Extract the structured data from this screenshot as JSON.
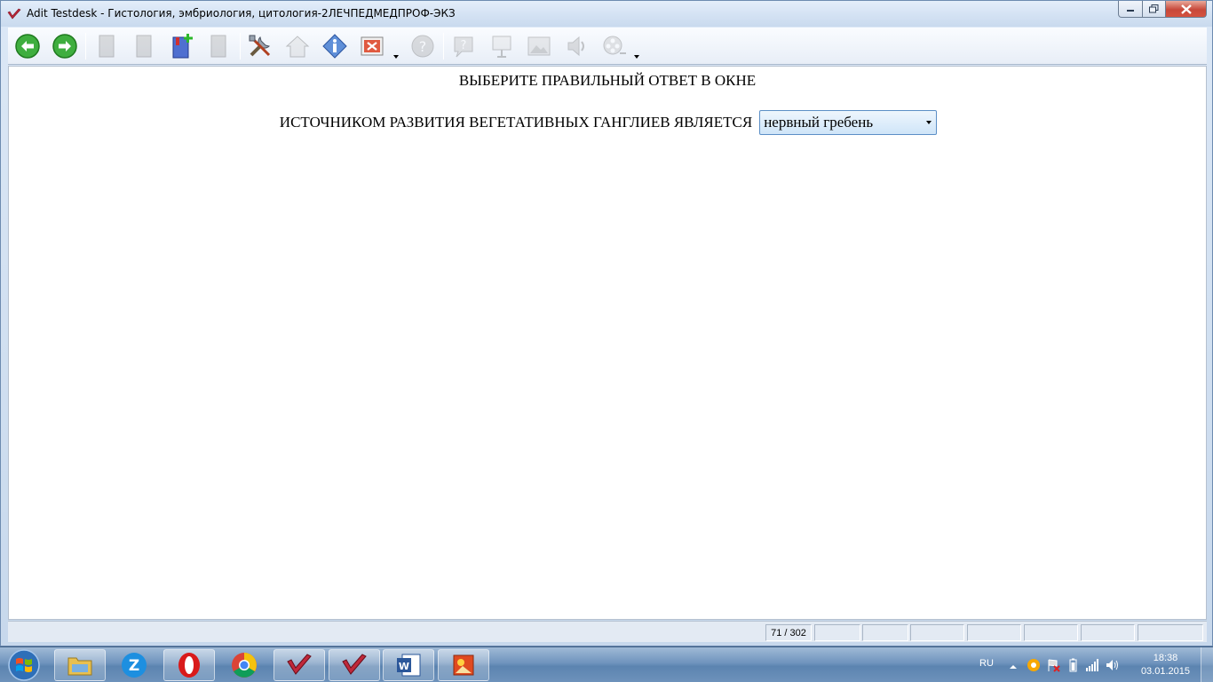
{
  "window": {
    "title": "Adit Testdesk - Гистология, эмбриология, цитология-2ЛЕЧПЕДМЕДПРОФ-ЭКЗ"
  },
  "toolbar": {
    "buttons": [
      {
        "name": "back",
        "icon": "arrow-left-circle-icon",
        "enabled": true
      },
      {
        "name": "forward",
        "icon": "arrow-right-circle-icon",
        "enabled": true
      },
      {
        "name": "doc-1",
        "icon": "document-icon",
        "enabled": false
      },
      {
        "name": "doc-2",
        "icon": "document-icon",
        "enabled": false
      },
      {
        "name": "add-bookmark",
        "icon": "bookmark-add-icon",
        "enabled": true
      },
      {
        "name": "doc-3",
        "icon": "document-icon",
        "enabled": false
      },
      {
        "name": "tools",
        "icon": "tools-icon",
        "enabled": true
      },
      {
        "name": "home",
        "icon": "home-icon",
        "enabled": false
      },
      {
        "name": "info",
        "icon": "info-icon",
        "enabled": true
      },
      {
        "name": "close-test",
        "icon": "close-window-icon",
        "enabled": true
      },
      {
        "name": "help",
        "icon": "help-icon",
        "enabled": false
      },
      {
        "name": "hint",
        "icon": "question-bubble-icon",
        "enabled": false
      },
      {
        "name": "presentation",
        "icon": "presentation-icon",
        "enabled": false
      },
      {
        "name": "image",
        "icon": "image-icon",
        "enabled": false
      },
      {
        "name": "sound",
        "icon": "speaker-icon",
        "enabled": false
      },
      {
        "name": "video",
        "icon": "film-reel-icon",
        "enabled": false
      }
    ]
  },
  "content": {
    "instruction": "ВЫБЕРИТЕ ПРАВИЛЬНЫЙ ОТВЕТ В ОКНЕ",
    "question": "ИСТОЧНИКОМ РАЗВИТИЯ ВЕГЕТАТИВНЫХ ГАНГЛИЕВ ЯВЛЯЕТСЯ",
    "answer_selected": "нервный гребень"
  },
  "statusbar": {
    "progress": "71 / 302"
  },
  "taskbar": {
    "language": "RU",
    "time": "18:38",
    "date": "03.01.2015"
  },
  "colors": {
    "accent": "#5c8fc6",
    "app_red": "#c0283a",
    "title_bg": "#dce8f6"
  }
}
